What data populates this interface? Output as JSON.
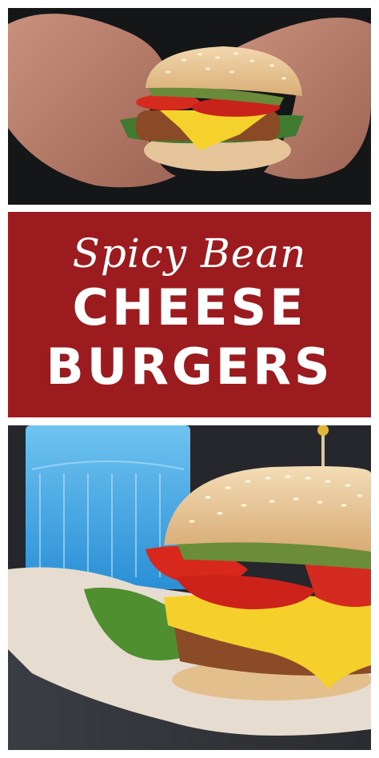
{
  "banner": {
    "line1": "Spicy Bean",
    "line2": "CHEESE",
    "line3": "BURGERS",
    "background_color": "#9b1b1e",
    "text_color": "#ffffff"
  },
  "photos": {
    "top": {
      "subject": "hands-holding-burger-photo"
    },
    "bottom": {
      "subject": "bean-burger-with-blue-glass-photo"
    }
  }
}
